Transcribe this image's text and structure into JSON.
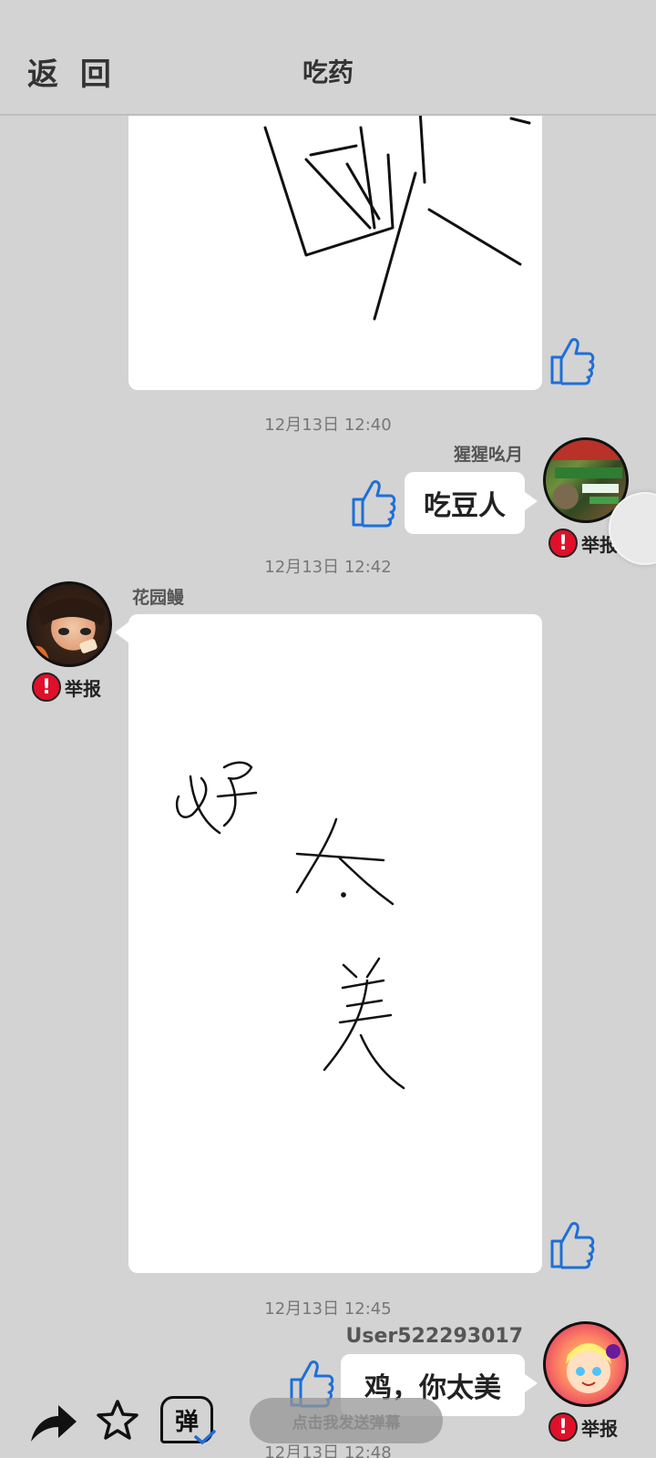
{
  "header": {
    "back_label": "返 回",
    "title": "吃药"
  },
  "messages": [
    {
      "type": "drawing",
      "side": "left"
    },
    {
      "timestamp": "12月13日  12:40",
      "sender": "猩猩吆月",
      "text": "吃豆人",
      "report_label": "举报",
      "side": "right"
    },
    {
      "timestamp": "12月13日  12:42",
      "sender": "花园鳗",
      "report_label": "举报",
      "type": "drawing",
      "side": "left"
    },
    {
      "timestamp": "12月13日  12:45",
      "sender": "User522293017",
      "text": "鸡，你太美",
      "report_label": "举报",
      "side": "right"
    },
    {
      "timestamp": "12月13日  12:48"
    }
  ],
  "bottom_bar": {
    "danmu_placeholder": "点击我发送弹幕",
    "danmu_icon_label": "弹",
    "icons": [
      "share-icon",
      "star-icon",
      "danmu-icon"
    ]
  },
  "colors": {
    "background": "#d3d3d3",
    "thumb_blue": "#1e6fd8",
    "report_red": "#e0102a"
  }
}
